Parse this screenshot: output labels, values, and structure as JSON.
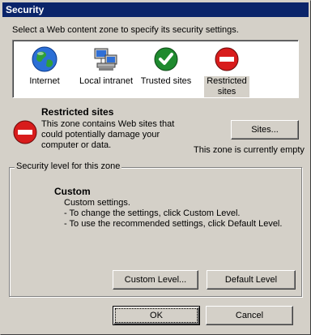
{
  "window": {
    "title": "Security"
  },
  "instruction": "Select a Web content zone to specify its security settings.",
  "zones": [
    {
      "label": "Internet",
      "icon": "globe-icon"
    },
    {
      "label": "Local intranet",
      "icon": "network-computer-icon"
    },
    {
      "label": "Trusted sites",
      "icon": "checkmark-icon"
    },
    {
      "label": "Restricted sites",
      "icon": "no-entry-icon"
    }
  ],
  "selected_zone": {
    "title": "Restricted sites",
    "description": "This zone contains Web sites that could potentially damage your computer or data.",
    "status": "This zone is currently empty",
    "sites_button": "Sites..."
  },
  "security_level": {
    "group_label": "Security level for this zone",
    "title": "Custom",
    "lines": [
      "Custom settings.",
      "- To change the settings, click Custom Level.",
      "- To use the recommended settings, click Default Level."
    ],
    "custom_level_button": "Custom Level...",
    "default_level_button": "Default Level"
  },
  "buttons": {
    "ok": "OK",
    "cancel": "Cancel"
  },
  "colors": {
    "titlebar": "#0a246a",
    "face": "#d4d0c8",
    "restricted_red": "#d81c1c",
    "trusted_green": "#1f8a2f"
  }
}
